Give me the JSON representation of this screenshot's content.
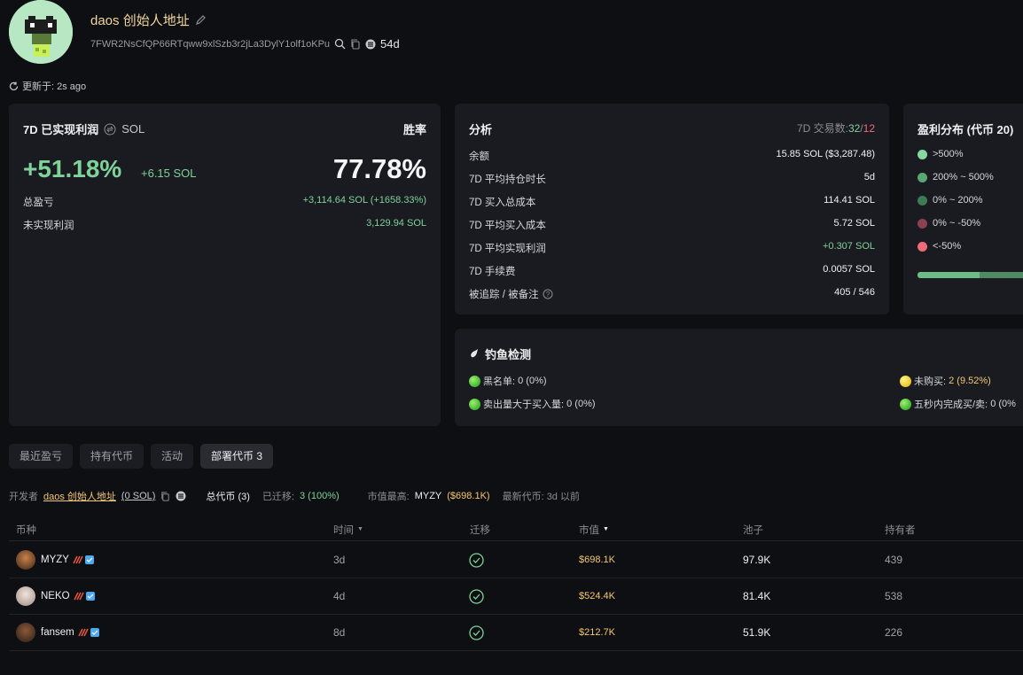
{
  "profile": {
    "name": "daos 创始人地址",
    "address": "7FWR2NsCfQP66RTqww9xlSzb3r2jLa3DylY1olf1oKPu",
    "age": "54d",
    "updated": "更新于: 2s ago"
  },
  "pnl_card": {
    "title": "7D 已实现利润",
    "unit": "SOL",
    "winrate_label": "胜率",
    "pnl_pct": "+51.18%",
    "pnl_sol": "+6.15 SOL",
    "winrate": "77.78%",
    "total_pnl_label": "总盈亏",
    "total_pnl": "+3,114.64 SOL (+1658.33%)",
    "unrealized_label": "未实现利润",
    "unrealized": "3,129.94 SOL"
  },
  "analysis": {
    "title": "分析",
    "tx_label": "7D 交易数:",
    "tx_buy": "32",
    "tx_slash": "/",
    "tx_sell": "12",
    "rows": [
      {
        "label": "余额",
        "value": "15.85 SOL ($3,287.48)"
      },
      {
        "label": "7D 平均持仓时长",
        "value": "5d"
      },
      {
        "label": "7D 买入总成本",
        "value": "114.41 SOL"
      },
      {
        "label": "7D 平均买入成本",
        "value": "5.72 SOL"
      },
      {
        "label": "7D 平均实现利润",
        "value": "+0.307 SOL"
      },
      {
        "label": "7D 手续费",
        "value": "0.0057 SOL"
      },
      {
        "label": "被追踪 / 被备注",
        "value": "405 / 546"
      }
    ]
  },
  "distribution": {
    "title": "盈利分布 (代币 20)",
    "items": [
      {
        "label": ">500%",
        "color": "#86d7a1"
      },
      {
        "label": "200% ~ 500%",
        "color": "#5aa772"
      },
      {
        "label": "0% ~ 200%",
        "color": "#3f7a56"
      },
      {
        "label": "0% ~ -50%",
        "color": "#8a4250"
      },
      {
        "label": "<-50%",
        "color": "#ef6b7a"
      }
    ]
  },
  "phishing": {
    "title": "钓鱼检测",
    "items": [
      {
        "label": "黑名单:",
        "value": "0 (0%)",
        "status": "green"
      },
      {
        "label": "未购买:",
        "value": "2 (9.52%)",
        "status": "yellow"
      },
      {
        "label": "卖出量大于买入量:",
        "value": "0 (0%)",
        "status": "green"
      },
      {
        "label": "五秒内完成买/卖:",
        "value": "0 (0%",
        "status": "green"
      }
    ]
  },
  "tabs": [
    "最近盈亏",
    "持有代币",
    "活动",
    "部署代币 3"
  ],
  "infobar": {
    "dev_label": "开发者",
    "dev_name": "daos 创始人地址",
    "dev_sol": "(0 SOL)",
    "total": "总代币 (3)",
    "migrated_label": "已迁移:",
    "migrated": "3 (100%)",
    "top_label": "市值最高:",
    "top_token": "MYZY",
    "top_mc": "($698.1K)",
    "latest": "最新代币: 3d 以前"
  },
  "table": {
    "headers": [
      "币种",
      "时间",
      "迁移",
      "市值",
      "池子",
      "持有者"
    ],
    "rows": [
      {
        "coin": "MYZY",
        "time": "3d",
        "mc": "$698.1K",
        "pool": "97.9K",
        "holders": "439"
      },
      {
        "coin": "NEKO",
        "time": "4d",
        "mc": "$524.4K",
        "pool": "81.4K",
        "holders": "538"
      },
      {
        "coin": "fansem",
        "time": "8d",
        "mc": "$212.7K",
        "pool": "51.9K",
        "holders": "226"
      }
    ]
  }
}
